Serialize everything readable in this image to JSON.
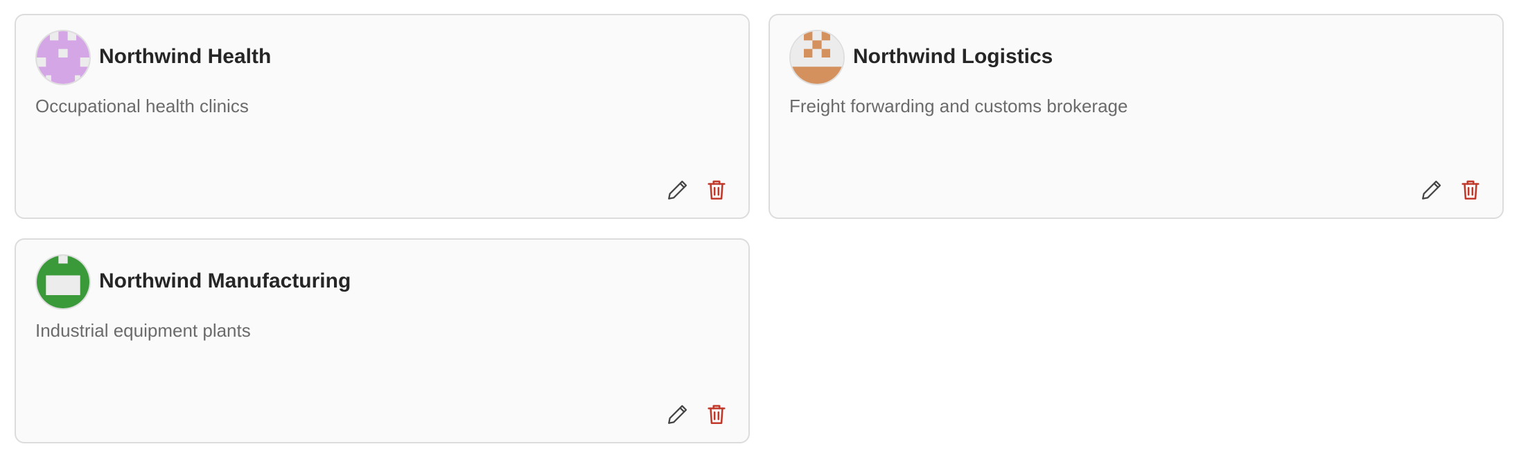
{
  "colors": {
    "card_bg": "#fafafa",
    "card_border": "#dcdcdc",
    "title": "#262626",
    "description": "#6b6b6b",
    "edit_icon": "#444444",
    "delete_icon": "#c0392b",
    "avatar_health": "#d5a6e6",
    "avatar_logistics": "#d4915e",
    "avatar_manufacturing": "#3a9a3a"
  },
  "cards": [
    {
      "name": "Northwind Health",
      "description": "Occupational health clinics",
      "avatar_icon": "identicon-avatar"
    },
    {
      "name": "Northwind Logistics",
      "description": "Freight forwarding and customs brokerage",
      "avatar_icon": "identicon-avatar"
    },
    {
      "name": "Northwind Manufacturing",
      "description": "Industrial equipment plants",
      "avatar_icon": "identicon-avatar"
    }
  ],
  "actions": {
    "edit_icon": "pencil-icon",
    "delete_icon": "trash-icon"
  }
}
